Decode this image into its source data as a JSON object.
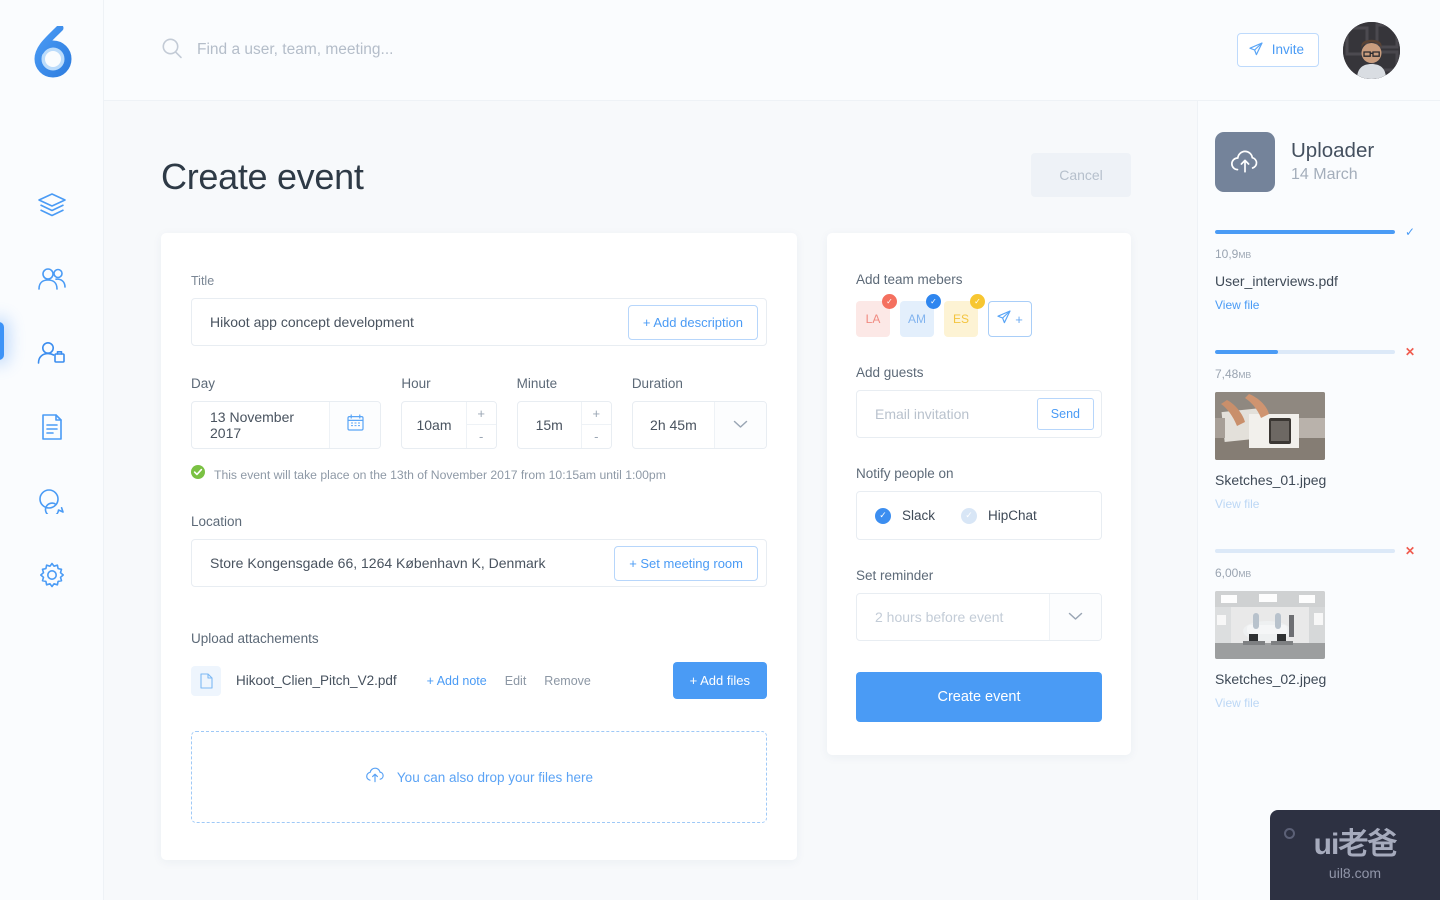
{
  "brand": {
    "logo_name": "hikoot-flame-logo",
    "accent": "#4a9bf5"
  },
  "sidebar": {
    "items": [
      {
        "name": "layers",
        "icon": "layers-icon",
        "active": false
      },
      {
        "name": "team",
        "icon": "users-icon",
        "active": false
      },
      {
        "name": "contacts",
        "icon": "user-card-icon",
        "active": true
      },
      {
        "name": "documents",
        "icon": "document-icon",
        "active": false
      },
      {
        "name": "messages",
        "icon": "chat-bubbles-icon",
        "active": false
      },
      {
        "name": "settings",
        "icon": "gear-icon",
        "active": false
      }
    ]
  },
  "topbar": {
    "search_placeholder": "Find a user, team, meeting...",
    "search_value": "",
    "search_icon": "search-icon",
    "invite_label": "Invite",
    "invite_icon": "paper-plane-icon",
    "avatar_name": "user-avatar"
  },
  "page": {
    "title": "Create event",
    "cancel_label": "Cancel"
  },
  "form": {
    "title_label": "Title",
    "title_value": "Hikoot app concept development",
    "add_description_label": "+ Add description",
    "day_label": "Day",
    "day_value": "13 November 2017",
    "calendar_icon": "calendar-icon",
    "hour_label": "Hour",
    "hour_value": "10am",
    "minute_label": "Minute",
    "minute_value": "15m",
    "duration_label": "Duration",
    "duration_value": "2h 45m",
    "stepper_plus": "+",
    "stepper_minus": "-",
    "confirm_text": "This event will take place on the 13th of November 2017 from 10:15am until 1:00pm",
    "confirm_icon": "check-circle-icon",
    "confirm_color": "#7ac143",
    "location_label": "Location",
    "location_value": "Store Kongensgade 66, 1264 København K, Denmark",
    "set_meeting_room_label": "+ Set meeting room",
    "upload_label": "Upload attachements",
    "attachment": {
      "icon": "file-icon",
      "name": "Hikoot_Clien_Pitch_V2.pdf",
      "add_note_label": "+ Add note",
      "edit_label": "Edit",
      "remove_label": "Remove"
    },
    "add_files_label": "+ Add files",
    "dropzone_label": "You can also drop your files here",
    "dropzone_icon": "cloud-upload-icon"
  },
  "panel": {
    "team_label": "Add team mebers",
    "members": [
      {
        "initials": "LA",
        "bg": "#fce8e6",
        "fg": "#f08a80",
        "badge_bg": "#f4705f",
        "badge_icon": "check-icon"
      },
      {
        "initials": "AM",
        "bg": "#e3effc",
        "fg": "#82b4ef",
        "badge_bg": "#2f86ef",
        "badge_icon": "check-icon"
      },
      {
        "initials": "ES",
        "bg": "#fdf3d4",
        "fg": "#f3c43e",
        "badge_bg": "#f7c631",
        "badge_icon": "check-icon"
      }
    ],
    "add_member_icon": "paper-plane-icon",
    "add_member_plus": "+",
    "guests_label": "Add guests",
    "guests_placeholder": "Email invitation",
    "guests_value": "",
    "send_label": "Send",
    "notify_label": "Notify people on",
    "notify_options": [
      {
        "label": "Slack",
        "selected": true
      },
      {
        "label": "HipChat",
        "selected": false
      }
    ],
    "reminder_label": "Set reminder",
    "reminder_placeholder": "2 hours before event",
    "reminder_value": "",
    "chevron_icon": "chevron-down-icon",
    "create_label": "Create event"
  },
  "uploader": {
    "icon": "cloud-upload-icon",
    "title": "Uploader",
    "date": "14 March",
    "files": [
      {
        "progress": 100,
        "status": "done",
        "status_icon": "check-icon",
        "size": "10,9",
        "size_unit": "MB",
        "name": "User_interviews.pdf",
        "view_label": "View file",
        "view_active": true,
        "thumb": "none"
      },
      {
        "progress": 35,
        "status": "uploading",
        "status_icon": "close-icon",
        "size": "7,48",
        "size_unit": "MB",
        "name": "Sketches_01.jpeg",
        "view_label": "View file",
        "view_active": false,
        "thumb": "desk-notebook-photo"
      },
      {
        "progress": 0,
        "status": "queued",
        "status_icon": "close-icon",
        "size": "6,00",
        "size_unit": "MB",
        "name": "Sketches_02.jpeg",
        "view_label": "View file",
        "view_active": false,
        "thumb": "car-studio-photo"
      }
    ]
  },
  "watermark": {
    "main": "ui老爸",
    "sub": "uil8.com"
  }
}
